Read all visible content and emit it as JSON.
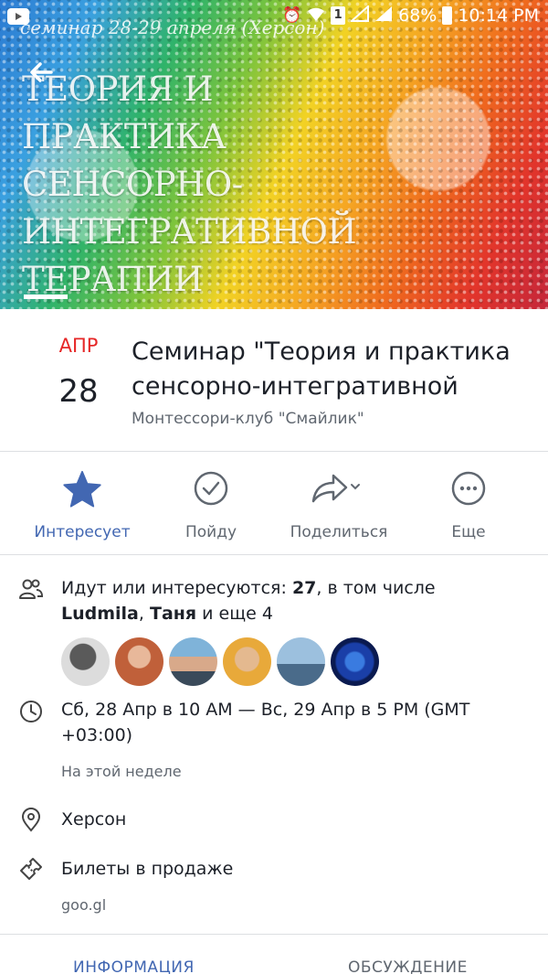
{
  "status_bar": {
    "battery_percent": "68%",
    "time": "10:14 PM",
    "sim_label": "1"
  },
  "cover": {
    "caption": "семинар 28-29 апреля (Херсон)",
    "title_lines": [
      "ТЕОРИЯ И",
      "ПРАКТИКА",
      "СЕНСОРНО-",
      "ИНТЕГРАТИВНОЙ",
      "ТЕРАПИИ"
    ]
  },
  "event": {
    "month": "АПР",
    "day": "28",
    "title_line1": "Семинар \"Теория и практика",
    "title_line2": "сенсорно-интегративной",
    "host": "Монтессори-клуб \"Смайлик\""
  },
  "actions": {
    "interested": "Интересует",
    "going": "Пойду",
    "share": "Поделиться",
    "more": "Еще"
  },
  "details": {
    "guests_prefix": "Идут или интересуются: ",
    "guests_count": "27",
    "guests_mid": ", в том числе",
    "guest1": "Ludmila",
    "guests_sep": ", ",
    "guest2": "Таня",
    "guests_suffix": " и еще 4",
    "datetime_line1": "Сб, 28 Апр в 10 AM — Вс, 29 Апр в 5 PM (GMT",
    "datetime_line2": "+03:00)",
    "datetime_note": "На этой неделе",
    "location": "Херсон",
    "tickets": "Билеты в продаже",
    "tickets_link": "goo.gl"
  },
  "tabs": {
    "info": "ИНФОРМАЦИЯ",
    "discussion": "ОБСУЖДЕНИЕ"
  },
  "colors": {
    "accent": "#4267b2",
    "month_red": "#e62727",
    "text_secondary": "#606770",
    "divider": "#dddfe2"
  }
}
